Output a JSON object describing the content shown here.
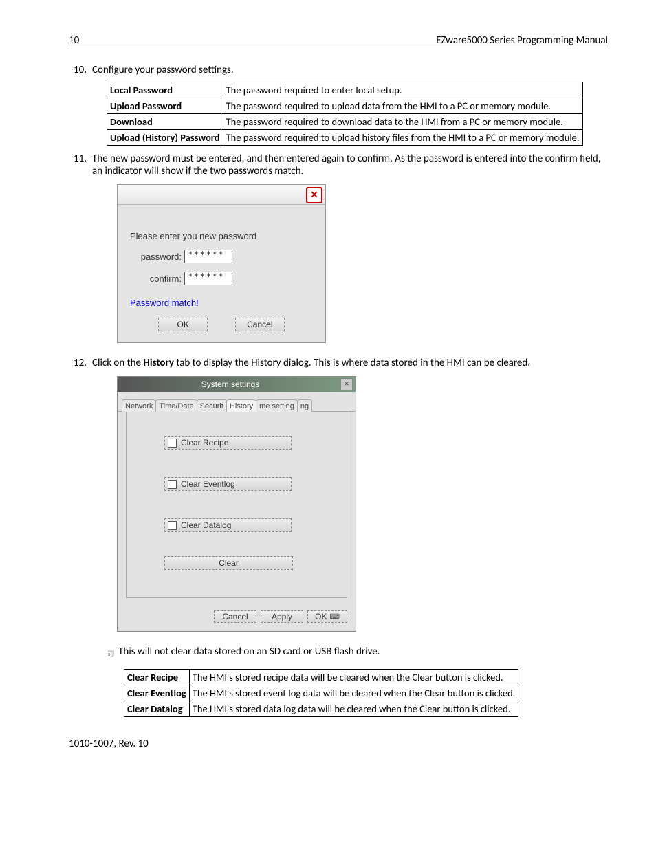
{
  "header": {
    "page_num": "10",
    "doc_title": "EZware5000 Series Programming Manual"
  },
  "step10": {
    "num": "10.",
    "text": "Configure your password settings."
  },
  "table1": {
    "rows": [
      {
        "k": "Local Password",
        "v": "The password required to enter local setup."
      },
      {
        "k": "Upload Password",
        "v": "The password required to upload data from the HMI to a PC or memory module."
      },
      {
        "k": "Download",
        "v": "The password required to download data to the HMI from a PC or memory module."
      },
      {
        "k": "Upload (History) Password",
        "v": "The password required to upload history files from the HMI to a PC or memory module."
      }
    ]
  },
  "step11": {
    "num": "11.",
    "text": "The new password must be entered, and then entered again to confirm. As the password is entered into the confirm field, an indicator will show if the two passwords match."
  },
  "pw_dlg": {
    "prompt": "Please enter you new password",
    "password_label": "password:",
    "confirm_label": "confirm:",
    "password_value": "******",
    "confirm_value": "******",
    "match_text": "Password match!",
    "ok": "OK",
    "cancel": "Cancel"
  },
  "step12": {
    "num": "12.",
    "pre": "Click on the ",
    "bold": "History",
    "post": " tab to display the History dialog. This is where data stored in the HMI can be cleared."
  },
  "ss_dlg": {
    "title": "System settings",
    "tabs": [
      "Network",
      "Time/Date",
      "Securit",
      "History",
      "me setting",
      "ng"
    ],
    "clear_recipe": "Clear Recipe",
    "clear_eventlog": "Clear Eventlog",
    "clear_datalog": "Clear Datalog",
    "clear": "Clear",
    "cancel": "Cancel",
    "apply": "Apply",
    "ok": "OK"
  },
  "note": "This will not clear data stored on an SD card or USB flash drive.",
  "table2": {
    "rows": [
      {
        "k": "Clear Recipe",
        "v": "The HMI's stored recipe data will be cleared when the Clear button is clicked."
      },
      {
        "k": "Clear Eventlog",
        "v": "The HMI's stored event log data will be cleared when the Clear button is clicked."
      },
      {
        "k": "Clear Datalog",
        "v": "The HMI's stored data log data will be cleared when the Clear button is clicked."
      }
    ]
  },
  "footer": "1010-1007, Rev. 10"
}
